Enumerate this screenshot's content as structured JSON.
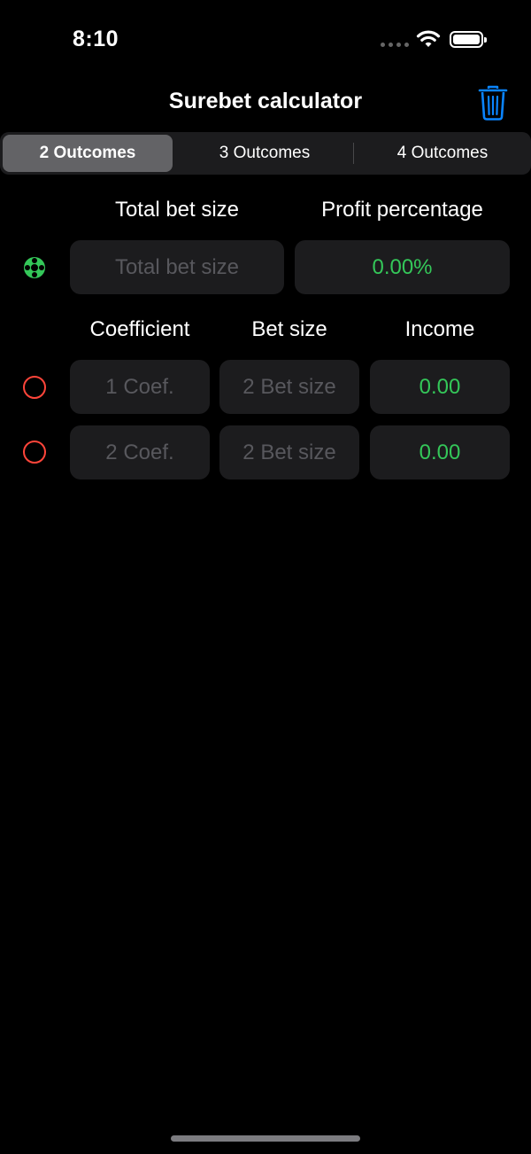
{
  "status_bar": {
    "time": "8:10"
  },
  "nav": {
    "title": "Surebet calculator",
    "trash_icon": "trash-icon"
  },
  "tabs": [
    {
      "label": "2 Outcomes",
      "selected": true
    },
    {
      "label": "3 Outcomes",
      "selected": false
    },
    {
      "label": "4 Outcomes",
      "selected": false
    }
  ],
  "summary": {
    "total_label": "Total bet size",
    "profit_label": "Profit percentage",
    "total_placeholder": "Total bet size",
    "total_value": "",
    "profit_value": "0.00%"
  },
  "columns": {
    "coefficient": "Coefficient",
    "bet_size": "Bet size",
    "income": "Income"
  },
  "outcomes": [
    {
      "coef_placeholder": "1 Coef.",
      "bet_placeholder": "2 Bet size",
      "income": "0.00"
    },
    {
      "coef_placeholder": "2 Coef.",
      "bet_placeholder": "2 Bet size",
      "income": "0.00"
    }
  ],
  "colors": {
    "accent_green": "#34c759",
    "accent_red": "#ff453a",
    "accent_blue": "#0a84ff",
    "field_bg": "#1c1c1e"
  }
}
